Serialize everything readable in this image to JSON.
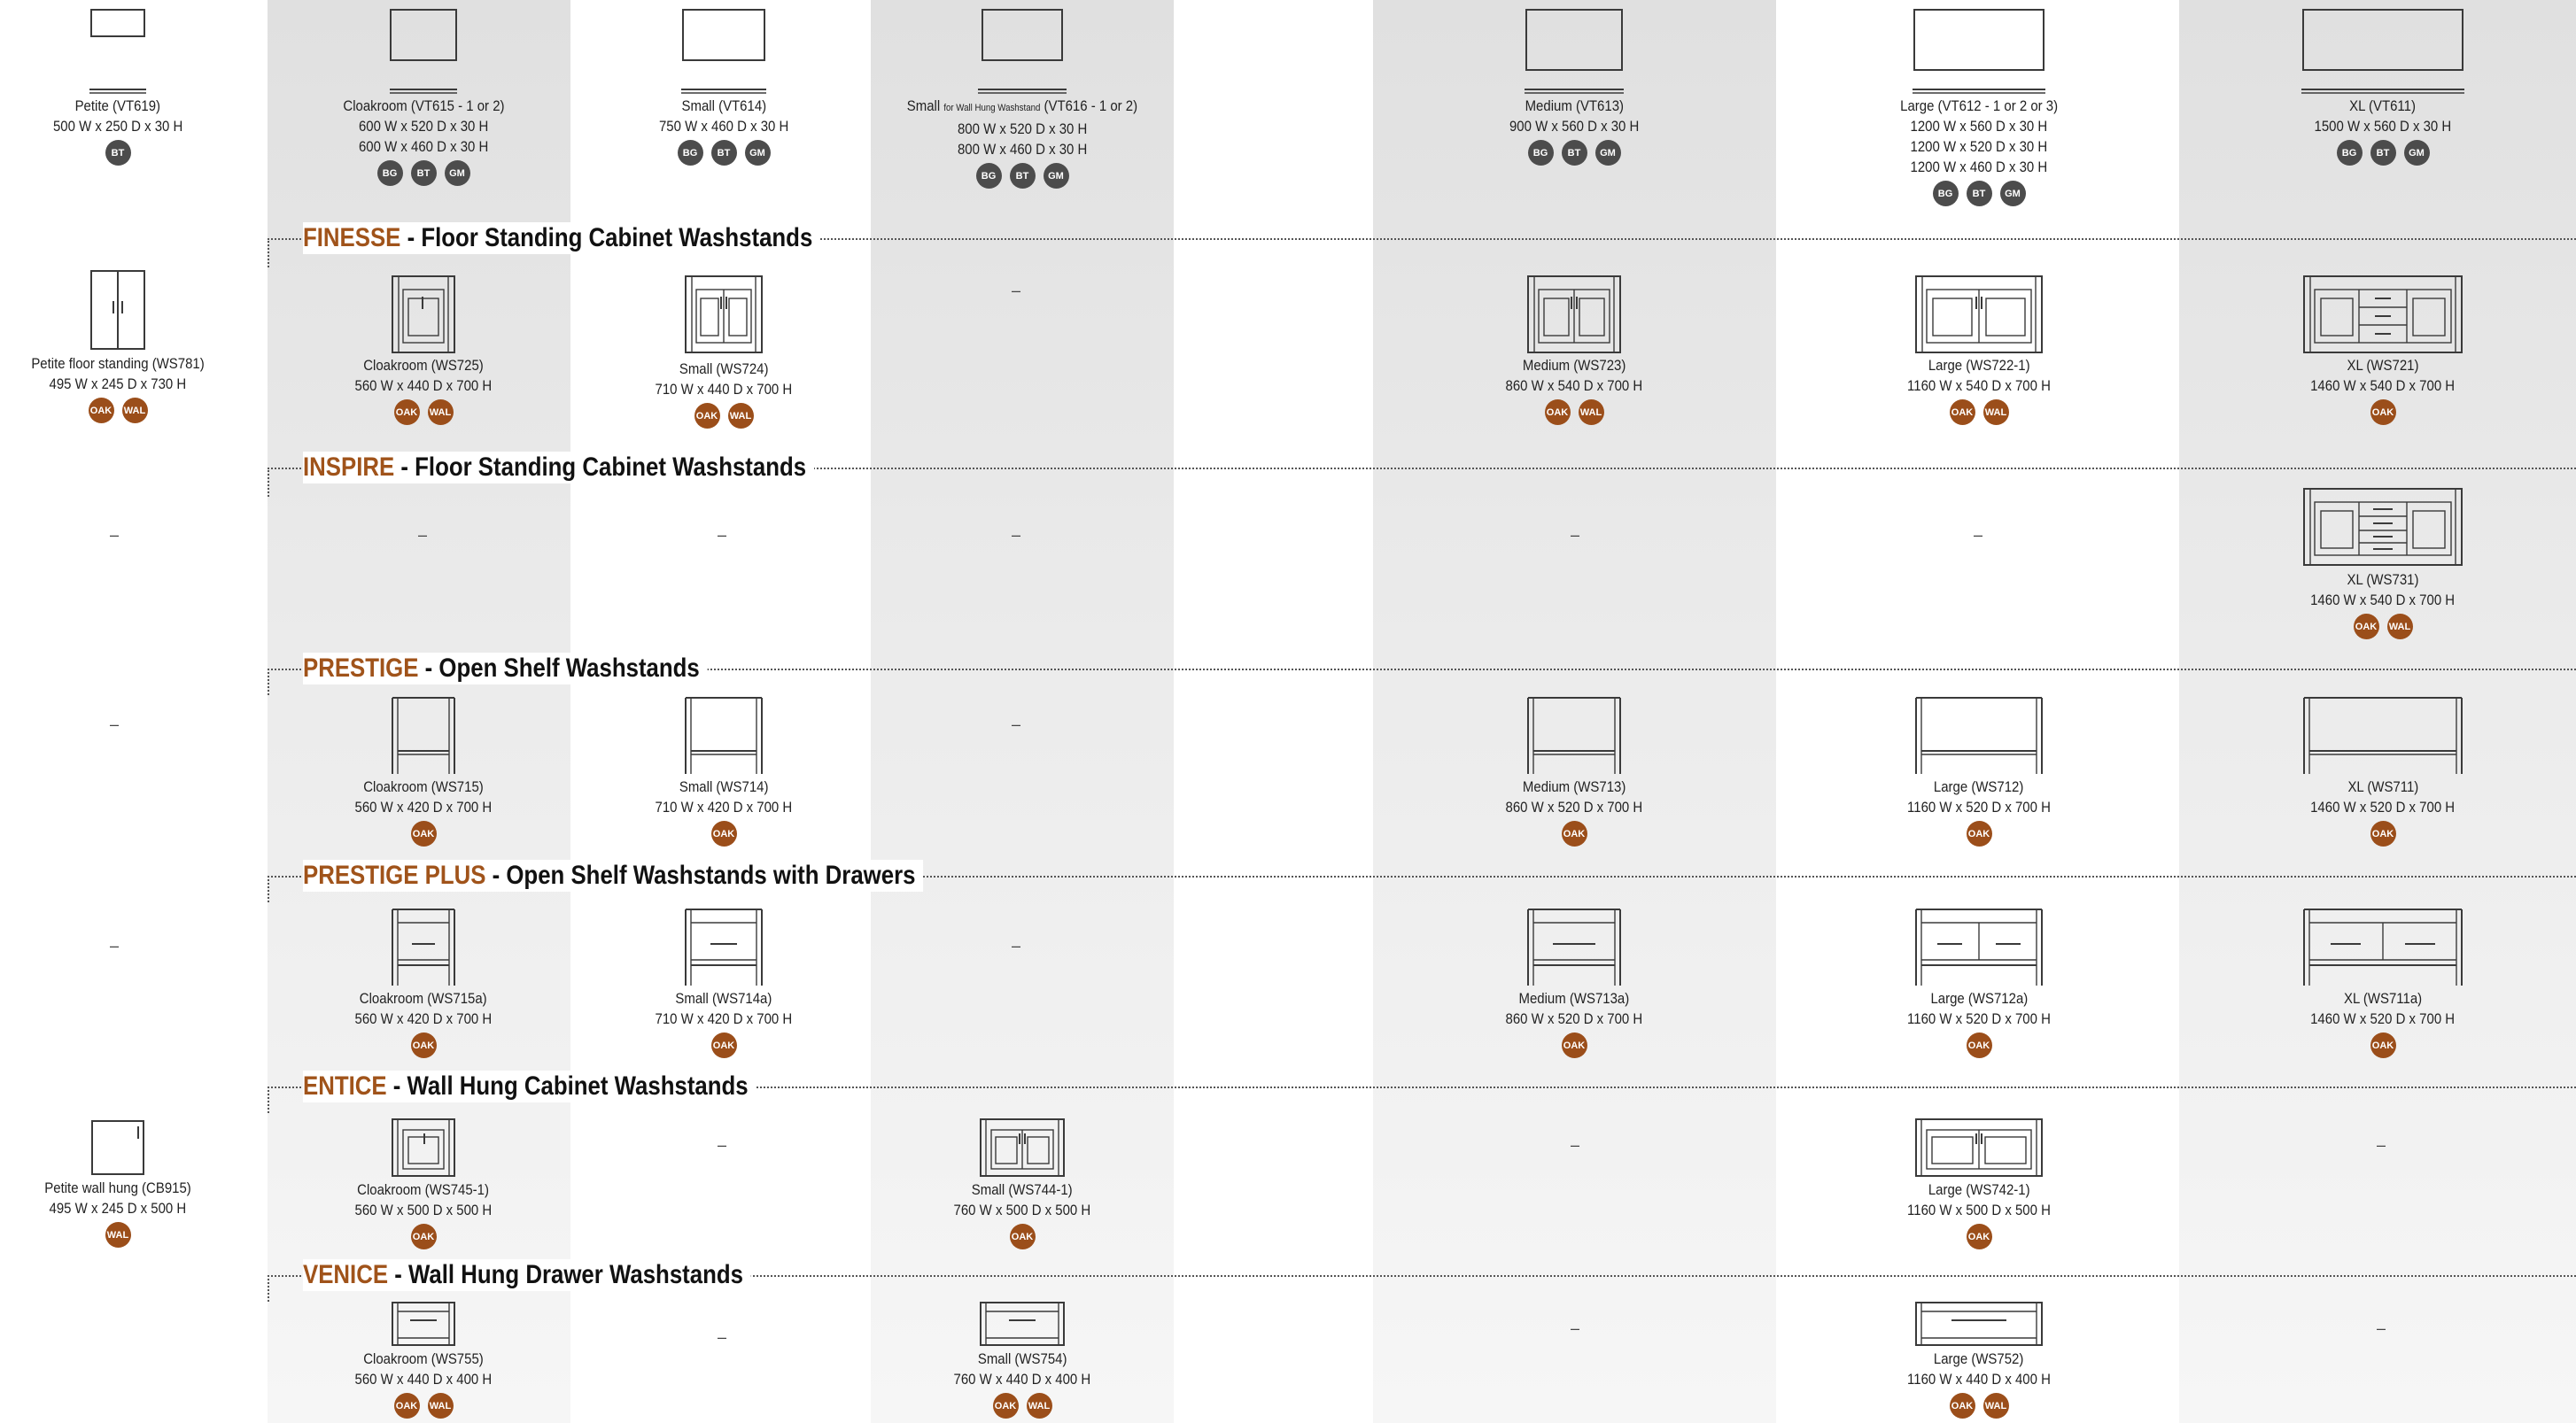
{
  "basins": {
    "petite": {
      "name": "Petite (VT619)",
      "dims": [
        "500 W x 250 D x 30 H"
      ],
      "badges": [
        "BT"
      ]
    },
    "cloakroom": {
      "name": "Cloakroom (VT615 - 1 or 2)",
      "dims": [
        "600 W x 520 D x 30 H",
        "600 W x 460 D x 30 H"
      ],
      "badges": [
        "BG",
        "BT",
        "GM"
      ]
    },
    "small": {
      "name": "Small (VT614)",
      "dims": [
        "750 W x 460 D x 30 H"
      ],
      "badges": [
        "BG",
        "BT",
        "GM"
      ]
    },
    "small_wall": {
      "name_pre": "Small ",
      "name_small": "for Wall Hung Washstand",
      "name_post": " (VT616 - 1 or 2)",
      "dims": [
        "800 W x 520 D x 30 H",
        "800 W x 460 D x 30 H"
      ],
      "badges": [
        "BG",
        "BT",
        "GM"
      ]
    },
    "medium": {
      "name": "Medium (VT613)",
      "dims": [
        "900 W x 560 D x 30 H"
      ],
      "badges": [
        "BG",
        "BT",
        "GM"
      ]
    },
    "large": {
      "name": "Large (VT612 - 1 or 2 or 3)",
      "dims": [
        "1200 W x 560 D x 30 H",
        "1200 W x 520 D x 30 H",
        "1200 W x 460 D x 30 H"
      ],
      "badges": [
        "BG",
        "BT",
        "GM"
      ]
    },
    "xl": {
      "name": "XL (VT611)",
      "dims": [
        "1500 W x 560 D x 30 H"
      ],
      "badges": [
        "BG",
        "BT",
        "GM"
      ]
    }
  },
  "sections": {
    "finesse": {
      "series": "FINESSE",
      "rest": " - Floor Standing Cabinet Washstands"
    },
    "inspire": {
      "series": "INSPIRE",
      "rest": " - Floor Standing Cabinet Washstands"
    },
    "prestige": {
      "series": "PRESTIGE",
      "rest": " - Open Shelf Washstands"
    },
    "prestige_plus": {
      "series": "PRESTIGE PLUS",
      "rest": " - Open Shelf Washstands with Drawers"
    },
    "entice": {
      "series": "ENTICE",
      "rest": " - Wall Hung Cabinet Washstands"
    },
    "venice": {
      "series": "VENICE",
      "rest": " - Wall Hung Drawer Washstands"
    }
  },
  "finesse": {
    "petite": {
      "name": "Petite floor standing  (WS781)",
      "dims": "495 W x 245 D x 730 H",
      "badges": [
        "OAK",
        "WAL"
      ]
    },
    "cloakroom": {
      "name": "Cloakroom (WS725)",
      "dims": "560 W x 440 D x 700 H",
      "badges": [
        "OAK",
        "WAL"
      ]
    },
    "small": {
      "name": "Small  (WS724)",
      "dims": "710 W x 440 D x 700 H",
      "badges": [
        "OAK",
        "WAL"
      ]
    },
    "medium": {
      "name": "Medium  (WS723)",
      "dims": "860 W x 540 D x 700 H",
      "badges": [
        "OAK",
        "WAL"
      ]
    },
    "large": {
      "name": "Large  (WS722-1)",
      "dims": "1160 W x 540 D x 700 H",
      "badges": [
        "OAK",
        "WAL"
      ]
    },
    "xl": {
      "name": "XL  (WS721)",
      "dims": "1460 W x 540 D x 700 H",
      "badges": [
        "OAK"
      ]
    }
  },
  "inspire": {
    "xl": {
      "name": "XL  (WS731)",
      "dims": "1460 W x 540 D x 700 H",
      "badges": [
        "OAK",
        "WAL"
      ]
    }
  },
  "prestige": {
    "cloakroom": {
      "name": "Cloakroom (WS715)",
      "dims": "560 W x 420 D x 700 H",
      "badges": [
        "OAK"
      ]
    },
    "small": {
      "name": "Small  (WS714)",
      "dims": "710 W x 420 D x 700 H",
      "badges": [
        "OAK"
      ]
    },
    "medium": {
      "name": "Medium  (WS713)",
      "dims": "860 W x 520 D x 700 H",
      "badges": [
        "OAK"
      ]
    },
    "large": {
      "name": "Large  (WS712)",
      "dims": "1160 W x 520 D x 700 H",
      "badges": [
        "OAK"
      ]
    },
    "xl": {
      "name": "XL  (WS711)",
      "dims": "1460 W x 520 D x 700 H",
      "badges": [
        "OAK"
      ]
    }
  },
  "prestige_plus": {
    "cloakroom": {
      "name": "Cloakroom (WS715a)",
      "dims": "560 W x 420 D x 700 H",
      "badges": [
        "OAK"
      ]
    },
    "small": {
      "name": "Small  (WS714a)",
      "dims": "710 W x 420 D x 700 H",
      "badges": [
        "OAK"
      ]
    },
    "medium": {
      "name": "Medium  (WS713a)",
      "dims": "860 W x 520 D x 700 H",
      "badges": [
        "OAK"
      ]
    },
    "large": {
      "name": "Large  (WS712a)",
      "dims": "1160 W x 520 D x 700 H",
      "badges": [
        "OAK"
      ]
    },
    "xl": {
      "name": "XL  (WS711a)",
      "dims": "1460 W x 520 D x 700 H",
      "badges": [
        "OAK"
      ]
    }
  },
  "entice": {
    "petite": {
      "name": "Petite wall hung  (CB915)",
      "dims": "495 W x 245 D x 500 H",
      "badges": [
        "WAL"
      ]
    },
    "cloakroom": {
      "name": "Cloakroom  (WS745-1)",
      "dims": "560 W x 500 D x 500 H",
      "badges": [
        "OAK"
      ]
    },
    "small": {
      "name": "Small  (WS744-1)",
      "dims": "760 W x 500 D x 500 H",
      "badges": [
        "OAK"
      ]
    },
    "large": {
      "name": "Large  (WS742-1)",
      "dims": "1160 W x 500 D x 500 H",
      "badges": [
        "OAK"
      ]
    }
  },
  "venice": {
    "cloakroom": {
      "name": "Cloakroom (WS755)",
      "dims": "560 W x 440 D x 400 H",
      "badges": [
        "OAK",
        "WAL"
      ]
    },
    "small": {
      "name": "Small  (WS754)",
      "dims": "760 W x 440 D x 400 H",
      "badges": [
        "OAK",
        "WAL"
      ]
    },
    "large": {
      "name": "Large  (WS752)",
      "dims": "1160 W x 440 D x 400 H",
      "badges": [
        "OAK",
        "WAL"
      ]
    }
  },
  "dash": "–",
  "colors": {
    "series_accent": "#a0531a",
    "wood_badge": "#9b4e1a",
    "finish_badge": "#4c4c4c"
  }
}
